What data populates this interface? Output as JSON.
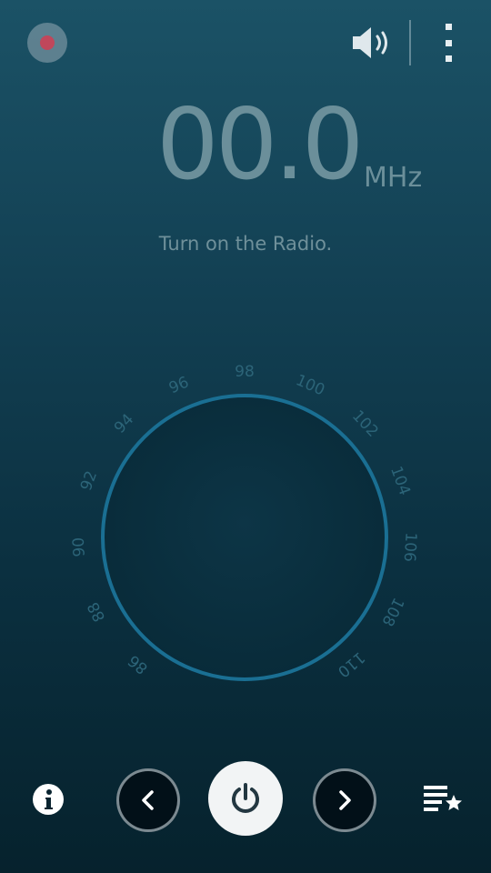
{
  "header": {
    "record_icon": "record-icon",
    "volume_icon": "speaker-icon",
    "menu_icon": "more-vertical-icon"
  },
  "frequency": {
    "value": "00.0",
    "unit": "MHz"
  },
  "status": "Turn on the Radio.",
  "dial": {
    "tick_labels": [
      "86",
      "88",
      "90",
      "92",
      "94",
      "96",
      "98",
      "100",
      "102",
      "104",
      "106",
      "108",
      "110"
    ]
  },
  "controls": {
    "info_icon": "info-icon",
    "prev_icon": "chevron-left-icon",
    "power_icon": "power-icon",
    "next_icon": "chevron-right-icon",
    "favorites_icon": "favorite-list-icon"
  },
  "colors": {
    "background_top": "#1b5266",
    "background_bottom": "#06222d",
    "dial_ring": "#1a6f93",
    "frequency_text": "#6b8f9a",
    "record_dot": "#c0475b"
  }
}
